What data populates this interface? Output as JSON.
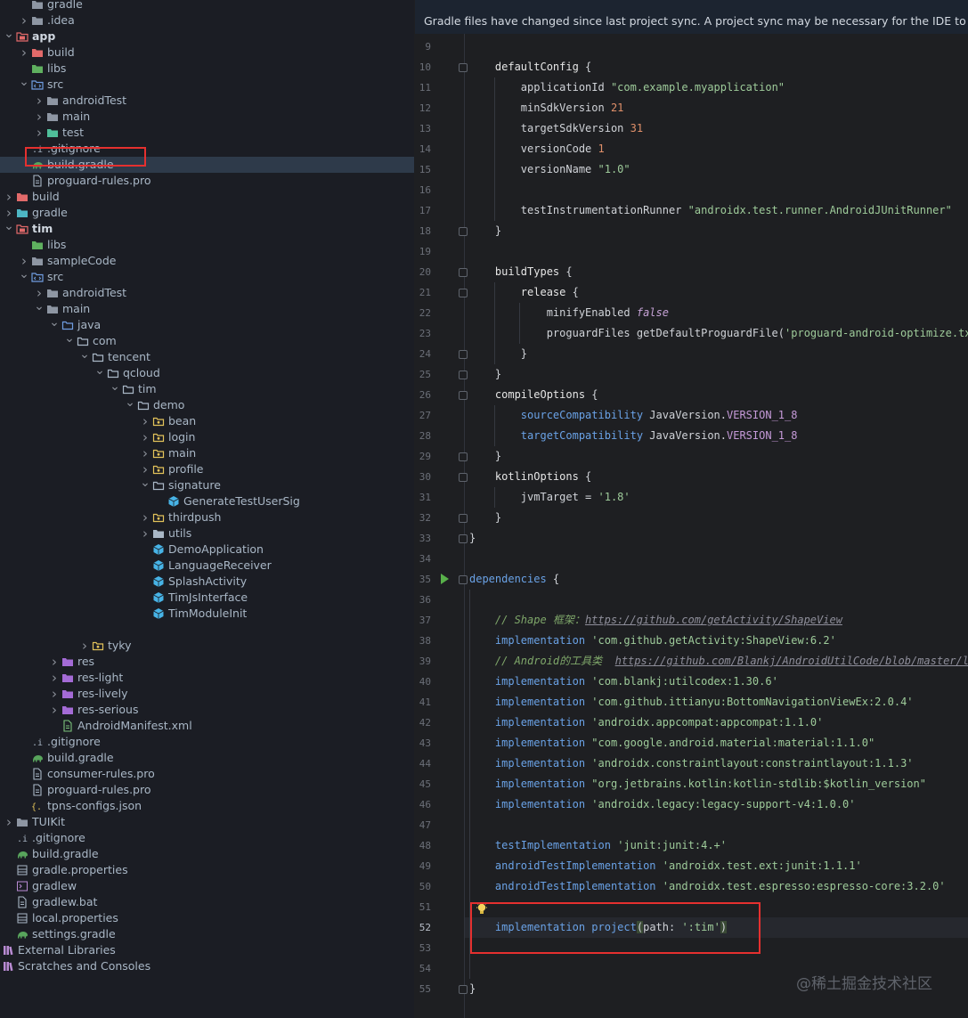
{
  "project_tree": [
    {
      "label": "gradle",
      "depth": 1,
      "arrow": "none",
      "icon": "folder-icon",
      "partial": true
    },
    {
      "label": ".idea",
      "depth": 1,
      "arrow": "right",
      "icon": "folder-icon"
    },
    {
      "label": "app",
      "depth": 0,
      "arrow": "down",
      "icon": "module-folder-icon",
      "bold": true
    },
    {
      "label": "build",
      "depth": 1,
      "arrow": "right",
      "icon": "build-folder-icon"
    },
    {
      "label": "libs",
      "depth": 1,
      "arrow": "none",
      "icon": "libs-folder-icon"
    },
    {
      "label": "src",
      "depth": 1,
      "arrow": "down",
      "icon": "source-folder-icon"
    },
    {
      "label": "androidTest",
      "depth": 2,
      "arrow": "right",
      "icon": "folder-icon"
    },
    {
      "label": "main",
      "depth": 2,
      "arrow": "right",
      "icon": "folder-icon"
    },
    {
      "label": "test",
      "depth": 2,
      "arrow": "right",
      "icon": "test-folder-icon"
    },
    {
      "label": ".gitignore",
      "depth": 1,
      "arrow": "none",
      "icon": "gitignore-file-icon"
    },
    {
      "label": "build.gradle",
      "depth": 1,
      "arrow": "none",
      "icon": "gradle-file-icon",
      "selected": true
    },
    {
      "label": "proguard-rules.pro",
      "depth": 1,
      "arrow": "none",
      "icon": "text-file-icon"
    },
    {
      "label": "build",
      "depth": 0,
      "arrow": "right",
      "icon": "build-folder-icon"
    },
    {
      "label": "gradle",
      "depth": 0,
      "arrow": "right",
      "icon": "gradle-folder-icon"
    },
    {
      "label": "tim",
      "depth": 0,
      "arrow": "down",
      "icon": "module-folder-icon",
      "bold": true
    },
    {
      "label": "libs",
      "depth": 1,
      "arrow": "none",
      "icon": "libs-folder-icon"
    },
    {
      "label": "sampleCode",
      "depth": 1,
      "arrow": "right",
      "icon": "folder-icon"
    },
    {
      "label": "src",
      "depth": 1,
      "arrow": "down",
      "icon": "source-folder-icon"
    },
    {
      "label": "androidTest",
      "depth": 2,
      "arrow": "right",
      "icon": "folder-icon"
    },
    {
      "label": "main",
      "depth": 2,
      "arrow": "down",
      "icon": "folder-icon"
    },
    {
      "label": "java",
      "depth": 3,
      "arrow": "down",
      "icon": "java-folder-icon"
    },
    {
      "label": "com",
      "depth": 4,
      "arrow": "down",
      "icon": "package-icon"
    },
    {
      "label": "tencent",
      "depth": 5,
      "arrow": "down",
      "icon": "package-icon"
    },
    {
      "label": "qcloud",
      "depth": 6,
      "arrow": "down",
      "icon": "package-icon"
    },
    {
      "label": "tim",
      "depth": 7,
      "arrow": "down",
      "icon": "package-icon"
    },
    {
      "label": "demo",
      "depth": 8,
      "arrow": "down",
      "icon": "package-icon"
    },
    {
      "label": "bean",
      "depth": 9,
      "arrow": "right",
      "icon": "package-dot-icon"
    },
    {
      "label": "login",
      "depth": 9,
      "arrow": "right",
      "icon": "package-dot-icon"
    },
    {
      "label": "main",
      "depth": 9,
      "arrow": "right",
      "icon": "package-dot-icon"
    },
    {
      "label": "profile",
      "depth": 9,
      "arrow": "right",
      "icon": "package-dot-icon"
    },
    {
      "label": "signature",
      "depth": 9,
      "arrow": "down",
      "icon": "package-icon"
    },
    {
      "label": "GenerateTestUserSig",
      "depth": 10,
      "arrow": "none",
      "icon": "java-class-icon"
    },
    {
      "label": "thirdpush",
      "depth": 9,
      "arrow": "right",
      "icon": "package-dot-icon"
    },
    {
      "label": "utils",
      "depth": 9,
      "arrow": "right",
      "icon": "utils-package-icon"
    },
    {
      "label": "DemoApplication",
      "depth": 9,
      "arrow": "none",
      "icon": "java-class-icon"
    },
    {
      "label": "LanguageReceiver",
      "depth": 9,
      "arrow": "none",
      "icon": "java-class-icon"
    },
    {
      "label": "SplashActivity",
      "depth": 9,
      "arrow": "none",
      "icon": "java-class-icon"
    },
    {
      "label": "TimJsInterface",
      "depth": 9,
      "arrow": "none",
      "icon": "java-class-icon"
    },
    {
      "label": "TimModuleInit",
      "depth": 9,
      "arrow": "none",
      "icon": "java-class-icon"
    },
    {
      "label": "",
      "depth": 0,
      "arrow": "none",
      "icon": "",
      "spacer": true
    },
    {
      "label": "tyky",
      "depth": 5,
      "arrow": "right",
      "icon": "package-dot-icon"
    },
    {
      "label": "res",
      "depth": 3,
      "arrow": "right",
      "icon": "res-folder-icon"
    },
    {
      "label": "res-light",
      "depth": 3,
      "arrow": "right",
      "icon": "res-folder-icon"
    },
    {
      "label": "res-lively",
      "depth": 3,
      "arrow": "right",
      "icon": "res-folder-icon"
    },
    {
      "label": "res-serious",
      "depth": 3,
      "arrow": "right",
      "icon": "res-folder-icon"
    },
    {
      "label": "AndroidManifest.xml",
      "depth": 3,
      "arrow": "none",
      "icon": "manifest-file-icon"
    },
    {
      "label": ".gitignore",
      "depth": 1,
      "arrow": "none",
      "icon": "gitignore-file-icon"
    },
    {
      "label": "build.gradle",
      "depth": 1,
      "arrow": "none",
      "icon": "gradle-file-icon"
    },
    {
      "label": "consumer-rules.pro",
      "depth": 1,
      "arrow": "none",
      "icon": "text-file-icon"
    },
    {
      "label": "proguard-rules.pro",
      "depth": 1,
      "arrow": "none",
      "icon": "text-file-icon"
    },
    {
      "label": "tpns-configs.json",
      "depth": 1,
      "arrow": "none",
      "icon": "json-file-icon"
    },
    {
      "label": "TUIKit",
      "depth": 0,
      "arrow": "right",
      "icon": "folder-icon"
    },
    {
      "label": ".gitignore",
      "depth": 0,
      "arrow": "none",
      "icon": "gitignore-file-icon"
    },
    {
      "label": "build.gradle",
      "depth": 0,
      "arrow": "none",
      "icon": "gradle-file-icon"
    },
    {
      "label": "gradle.properties",
      "depth": 0,
      "arrow": "none",
      "icon": "properties-file-icon"
    },
    {
      "label": "gradlew",
      "depth": 0,
      "arrow": "none",
      "icon": "shell-file-icon"
    },
    {
      "label": "gradlew.bat",
      "depth": 0,
      "arrow": "none",
      "icon": "text-file-icon"
    },
    {
      "label": "local.properties",
      "depth": 0,
      "arrow": "none",
      "icon": "properties-file-icon"
    },
    {
      "label": "settings.gradle",
      "depth": 0,
      "arrow": "none",
      "icon": "gradle-file-icon"
    },
    {
      "label": "External Libraries",
      "depth": -1,
      "arrow": "right",
      "icon": "libraries-icon"
    },
    {
      "label": "Scratches and Consoles",
      "depth": -1,
      "arrow": "none",
      "icon": "scratches-icon"
    }
  ],
  "editor": {
    "banner": "Gradle files have changed since last project sync. A project sync may be necessary for the IDE to work pr",
    "current_line": "52",
    "lines": [
      {
        "n": "9",
        "html": ""
      },
      {
        "n": "10",
        "tokens": [
          [
            "    ",
            ""
          ],
          [
            "defaultConfig",
            "fn"
          ],
          [
            " {",
            "k"
          ]
        ]
      },
      {
        "n": "11",
        "tokens": [
          [
            "        applicationId ",
            "k"
          ],
          [
            "\"com.example.myapplication\"",
            "str"
          ]
        ]
      },
      {
        "n": "12",
        "tokens": [
          [
            "        minSdkVersion ",
            "k"
          ],
          [
            "21",
            "num"
          ]
        ]
      },
      {
        "n": "13",
        "tokens": [
          [
            "        targetSdkVersion ",
            "k"
          ],
          [
            "31",
            "num"
          ]
        ]
      },
      {
        "n": "14",
        "tokens": [
          [
            "        versionCode ",
            "k"
          ],
          [
            "1",
            "num"
          ]
        ]
      },
      {
        "n": "15",
        "tokens": [
          [
            "        versionName ",
            "k"
          ],
          [
            "\"1.0\"",
            "str"
          ]
        ]
      },
      {
        "n": "16",
        "tokens": []
      },
      {
        "n": "17",
        "tokens": [
          [
            "        testInstrumentationRunner ",
            "k"
          ],
          [
            "\"androidx.test.runner.AndroidJUnitRunner\"",
            "str"
          ]
        ]
      },
      {
        "n": "18",
        "tokens": [
          [
            "    }",
            "k"
          ]
        ]
      },
      {
        "n": "19",
        "tokens": []
      },
      {
        "n": "20",
        "tokens": [
          [
            "    buildTypes",
            "fn"
          ],
          [
            " {",
            "k"
          ]
        ]
      },
      {
        "n": "21",
        "tokens": [
          [
            "        release",
            "fn"
          ],
          [
            " {",
            "k"
          ]
        ]
      },
      {
        "n": "22",
        "tokens": [
          [
            "            minifyEnabled ",
            "k"
          ],
          [
            "false",
            "italic"
          ]
        ]
      },
      {
        "n": "23",
        "tokens": [
          [
            "            proguardFiles getDefaultProguardFile(",
            "k"
          ],
          [
            "'proguard-android-optimize.txt'",
            "str"
          ],
          [
            "),",
            "k"
          ]
        ]
      },
      {
        "n": "24",
        "tokens": [
          [
            "        }",
            "k"
          ]
        ]
      },
      {
        "n": "25",
        "tokens": [
          [
            "    }",
            "k"
          ]
        ]
      },
      {
        "n": "26",
        "tokens": [
          [
            "    compileOptions",
            "fn"
          ],
          [
            " {",
            "k"
          ]
        ]
      },
      {
        "n": "27",
        "tokens": [
          [
            "        ",
            "k"
          ],
          [
            "sourceCompatibility ",
            "blue"
          ],
          [
            "JavaVersion.",
            "k"
          ],
          [
            "VERSION_1_8",
            "cst"
          ]
        ]
      },
      {
        "n": "28",
        "tokens": [
          [
            "        ",
            "k"
          ],
          [
            "targetCompatibility ",
            "blue"
          ],
          [
            "JavaVersion.",
            "k"
          ],
          [
            "VERSION_1_8",
            "cst"
          ]
        ]
      },
      {
        "n": "29",
        "tokens": [
          [
            "    }",
            "k"
          ]
        ]
      },
      {
        "n": "30",
        "tokens": [
          [
            "    kotlinOptions",
            "fn"
          ],
          [
            " {",
            "k"
          ]
        ]
      },
      {
        "n": "31",
        "tokens": [
          [
            "        jvmTarget = ",
            "k"
          ],
          [
            "'1.8'",
            "str"
          ]
        ]
      },
      {
        "n": "32",
        "tokens": [
          [
            "    }",
            "k"
          ]
        ]
      },
      {
        "n": "33",
        "tokens": [
          [
            "}",
            "k"
          ]
        ]
      },
      {
        "n": "34",
        "tokens": []
      },
      {
        "n": "35",
        "tokens": [
          [
            "dependencies",
            "blue"
          ],
          [
            " {",
            "k"
          ]
        ]
      },
      {
        "n": "36",
        "tokens": []
      },
      {
        "n": "37",
        "tokens": [
          [
            "    ",
            "k"
          ],
          [
            "// Shape 框架：",
            "cmt"
          ],
          [
            "https://github.com/getActivity/ShapeView",
            "url"
          ]
        ]
      },
      {
        "n": "38",
        "tokens": [
          [
            "    ",
            "k"
          ],
          [
            "implementation ",
            "blue"
          ],
          [
            "'com.github.getActivity:ShapeView:6.2'",
            "str"
          ]
        ]
      },
      {
        "n": "39",
        "tokens": [
          [
            "    ",
            "k"
          ],
          [
            "// Android的工具类  ",
            "cmt"
          ],
          [
            "https://github.com/Blankj/AndroidUtilCode/blob/master/lib/",
            "url"
          ]
        ]
      },
      {
        "n": "40",
        "tokens": [
          [
            "    ",
            "k"
          ],
          [
            "implementation ",
            "blue"
          ],
          [
            "'com.blankj:utilcodex:1.30.6'",
            "str"
          ]
        ]
      },
      {
        "n": "41",
        "tokens": [
          [
            "    ",
            "k"
          ],
          [
            "implementation ",
            "blue"
          ],
          [
            "'com.github.ittianyu:BottomNavigationViewEx:2.0.4'",
            "str"
          ]
        ]
      },
      {
        "n": "42",
        "tokens": [
          [
            "    ",
            "k"
          ],
          [
            "implementation ",
            "blue"
          ],
          [
            "'androidx.appcompat:appcompat:1.1.0'",
            "str"
          ]
        ]
      },
      {
        "n": "43",
        "tokens": [
          [
            "    ",
            "k"
          ],
          [
            "implementation ",
            "blue"
          ],
          [
            "\"com.google.android.material:material:1.1.0\"",
            "str"
          ]
        ]
      },
      {
        "n": "44",
        "tokens": [
          [
            "    ",
            "k"
          ],
          [
            "implementation ",
            "blue"
          ],
          [
            "'androidx.constraintlayout:constraintlayout:1.1.3'",
            "str"
          ]
        ]
      },
      {
        "n": "45",
        "tokens": [
          [
            "    ",
            "k"
          ],
          [
            "implementation ",
            "blue"
          ],
          [
            "\"org.jetbrains.kotlin:kotlin-stdlib:$kotlin_version\"",
            "str"
          ]
        ]
      },
      {
        "n": "46",
        "tokens": [
          [
            "    ",
            "k"
          ],
          [
            "implementation ",
            "blue"
          ],
          [
            "'androidx.legacy:legacy-support-v4:1.0.0'",
            "str"
          ]
        ]
      },
      {
        "n": "47",
        "tokens": []
      },
      {
        "n": "48",
        "tokens": [
          [
            "    ",
            "k"
          ],
          [
            "testImplementation ",
            "blue"
          ],
          [
            "'junit:junit:4.+'",
            "str"
          ]
        ]
      },
      {
        "n": "49",
        "tokens": [
          [
            "    ",
            "k"
          ],
          [
            "androidTestImplementation ",
            "blue"
          ],
          [
            "'androidx.test.ext:junit:1.1.1'",
            "str"
          ]
        ]
      },
      {
        "n": "50",
        "tokens": [
          [
            "    ",
            "k"
          ],
          [
            "androidTestImplementation ",
            "blue"
          ],
          [
            "'androidx.test.espresso:espresso-core:3.2.0'",
            "str"
          ]
        ]
      },
      {
        "n": "51",
        "tokens": []
      },
      {
        "n": "52",
        "tokens": [
          [
            "    ",
            "k"
          ],
          [
            "implementation ",
            "blue"
          ],
          [
            "project",
            "blue"
          ],
          [
            "(",
            "paren"
          ],
          [
            "path: ",
            "k"
          ],
          [
            "':tim'",
            "str"
          ],
          [
            ")",
            "paren"
          ]
        ]
      },
      {
        "n": "53",
        "tokens": []
      },
      {
        "n": "54",
        "tokens": []
      },
      {
        "n": "55",
        "tokens": [
          [
            "}",
            "k"
          ]
        ]
      }
    ]
  },
  "watermark": "@稀土掘金技术社区"
}
